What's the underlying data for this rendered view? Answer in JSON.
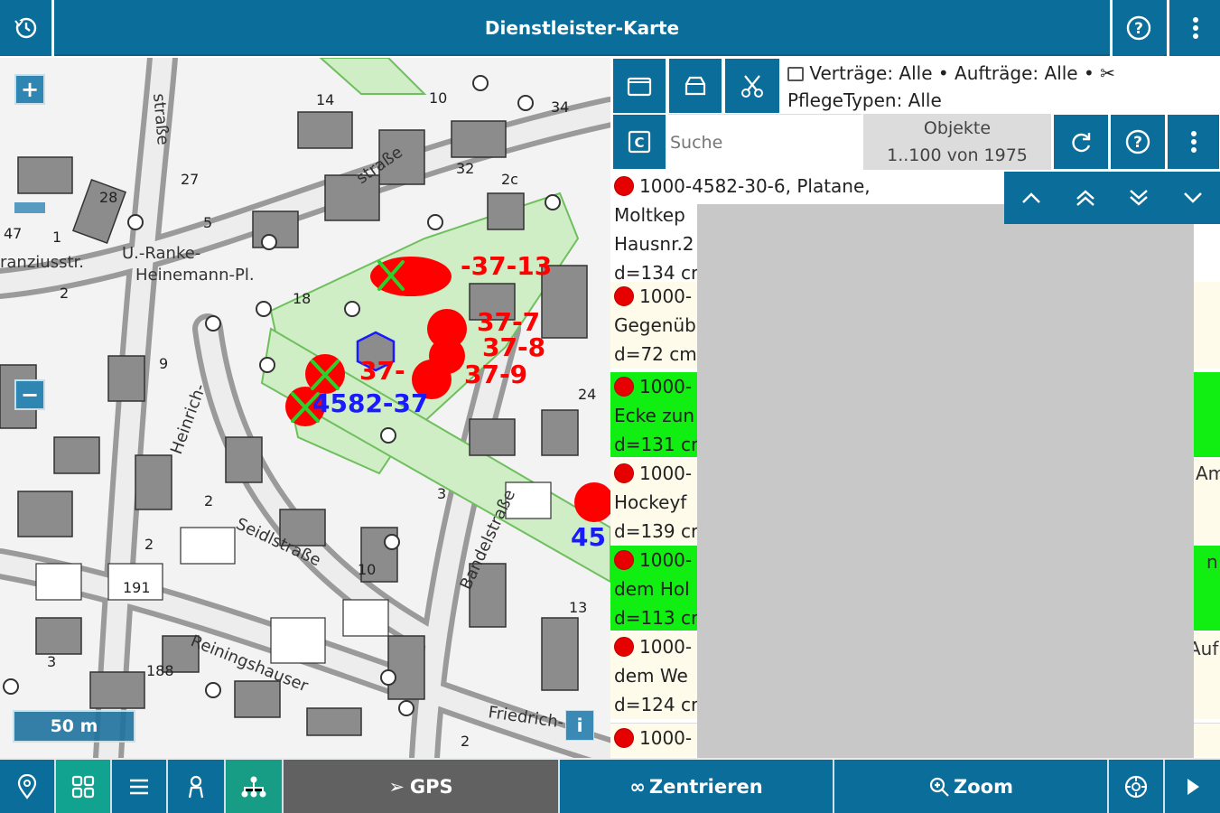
{
  "window": {
    "title": "Dienstleister-Karte"
  },
  "topbar": {
    "history_icon": "history-icon",
    "help_icon": "help-icon",
    "menu_icon": "more-vertical-icon"
  },
  "map": {
    "zoom_in": "+",
    "zoom_out": "−",
    "scale": "50 m",
    "info": "i",
    "street_labels": [
      "straße",
      "Heinrich-",
      "Seidlstraße",
      "Bandelstraße",
      "Reiningshauser",
      "Friedrich-",
      "U.-Ranke-",
      "Heinemann-Pl.",
      "ranziusstr.",
      "straße"
    ],
    "house_numbers": [
      "14",
      "10",
      "34",
      "27",
      "28",
      "32",
      "2c",
      "5",
      "1",
      "47",
      "2",
      "18",
      "9",
      "24",
      "3",
      "2",
      "10",
      "191",
      "188",
      "3",
      "13",
      "2",
      "2"
    ],
    "markers": [
      {
        "label": "37-7",
        "color": "#e60000"
      },
      {
        "label": "37-8",
        "color": "#e60000"
      },
      {
        "label": "37-9",
        "color": "#e60000"
      },
      {
        "label": "4582-37",
        "color": "#1a1aff"
      },
      {
        "label": "45",
        "color": "#1a1aff"
      }
    ],
    "accent_red": "#ff0000",
    "accent_green": "#2bd12b"
  },
  "panel": {
    "filters_line1": "Verträge: Alle • Aufträge: Alle •",
    "filters_line2": "PflegeTypen: Alle",
    "search_placeholder": "Suche",
    "objects_label": "Objekte",
    "objects_count": "1..100 von 1975",
    "items": [
      {
        "line1": "1000-4582-30-6, Platane,",
        "line2": "Moltkep",
        "line3": "Hausnr.2",
        "line4": "d=134 cr",
        "bg": "#ffffff"
      },
      {
        "line1": "1000-",
        "line2": "Gegenüb",
        "line3": "d=72 cm",
        "bg": "#fffbea"
      },
      {
        "line1": "1000-",
        "line2": "Ecke zun",
        "line3": "d=131 cr",
        "bg": "#11ee11"
      },
      {
        "line1": "1000-",
        "line2": "Hockeyf",
        "line3": "d=139 cr",
        "bg": "#fffbea"
      },
      {
        "line1": "1000-",
        "line2": "dem Hol",
        "line3": "d=113 cr",
        "bg": "#11ee11"
      },
      {
        "line1": "1000-",
        "line2": "dem We",
        "line3": "d=124 cr",
        "bg": "#fffbea"
      },
      {
        "line1": "1000-",
        "bg": "#fffbea"
      }
    ],
    "side_fragments": [
      "Am",
      "n",
      "Auf"
    ]
  },
  "bottombar": {
    "gps": "GPS",
    "center": "Zentrieren",
    "zoom": "Zoom"
  }
}
